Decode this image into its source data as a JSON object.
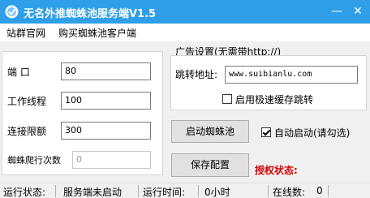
{
  "window": {
    "title": "无名外推蜘蛛池服务端V1.5",
    "title_bar_color": "#2e9fe8",
    "icon": "app-logo-icon",
    "controls": {
      "minimize": "—",
      "close": "✕"
    }
  },
  "menu": {
    "items": [
      {
        "label": "站群官网"
      },
      {
        "label": "购买蜘蛛池客户端"
      }
    ]
  },
  "settings": {
    "port": {
      "label": "端    口",
      "value": "80"
    },
    "worker_threads": {
      "label": "工作线程",
      "value": "100"
    },
    "connection_limit": {
      "label": "连接限额",
      "value": "300"
    },
    "crawl_count": {
      "label": "蜘蛛爬行次数",
      "value": "0"
    }
  },
  "ad_settings": {
    "title": "广告设置(无需带http://)",
    "redirect": {
      "label": "跳转地址:",
      "value": "www.suibianlu.com"
    },
    "fast_cache": {
      "label": "启用极速缓存跳转",
      "checked": false
    }
  },
  "actions": {
    "start_button": "启动蜘蛛池",
    "auto_start": {
      "label": "自动启动(请勾选)",
      "checked": true
    },
    "save_button": "保存配置",
    "license_label": "授权状态:",
    "license_color": "#d40000"
  },
  "status": {
    "run_label": "运行状态:",
    "run_value": "服务端未启动",
    "time_label": "运行时间:",
    "time_value": "0小时",
    "online_label": "在线数:",
    "online_value": "0"
  }
}
